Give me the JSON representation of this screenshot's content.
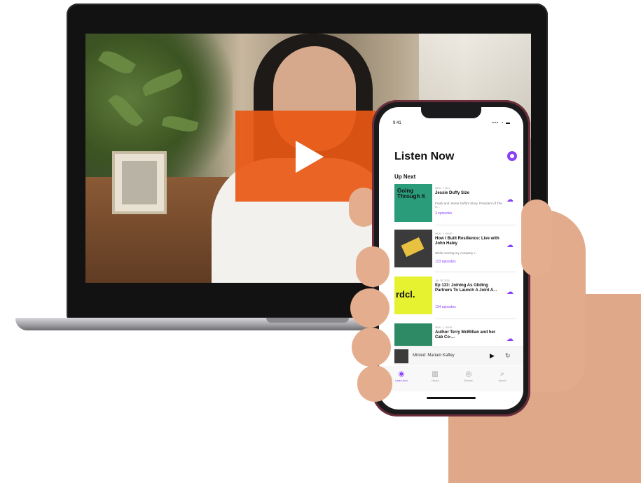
{
  "video": {
    "play_icon": "play-icon",
    "accent": "#E85814"
  },
  "phone": {
    "status": {
      "time": "9:41",
      "icons": "▪▪▪ ◔ ▬"
    },
    "app_title": "Listen Now",
    "section_title": "Up Next",
    "accent": "#8A3FFC",
    "episodes": [
      {
        "art_text": "Going Through It",
        "meta": "NEW · 7 MIN",
        "title": "Jessie Duffy Size",
        "desc": "Frank and Jessie Duffy's Story, President of The A...",
        "count": "3 episodes",
        "art_color": "#2A9C7A"
      },
      {
        "art_text": "",
        "meta": "NEW · 1 HOUR",
        "title": "How I Built Resilience: Live with John Haley",
        "desc": "While running my company I...",
        "count": "123 episodes",
        "art_color": "#3B3B3B"
      },
      {
        "art_text": "rdcl.",
        "meta": "JUL 28, 2018",
        "title": "Ep 133: Joining As Gliding Partners To Launch A Joint A...",
        "desc": "",
        "count": "134 episodes",
        "art_color": "#E6F230"
      },
      {
        "art_text": "",
        "meta": "NEW · 1 HOUR",
        "title": "Author Terry McMillan and her Cab Co-...",
        "desc": "",
        "count": "",
        "art_color": "#2E8A65"
      }
    ],
    "mini_player": {
      "title": "Minted: Mariam Kafley",
      "play": "▶",
      "skip": "↻"
    },
    "tabs": [
      {
        "icon": "◉",
        "label": "Listen Now"
      },
      {
        "icon": "▥",
        "label": "Library"
      },
      {
        "icon": "◎",
        "label": "Browse"
      },
      {
        "icon": "⌕",
        "label": "Search"
      }
    ]
  }
}
